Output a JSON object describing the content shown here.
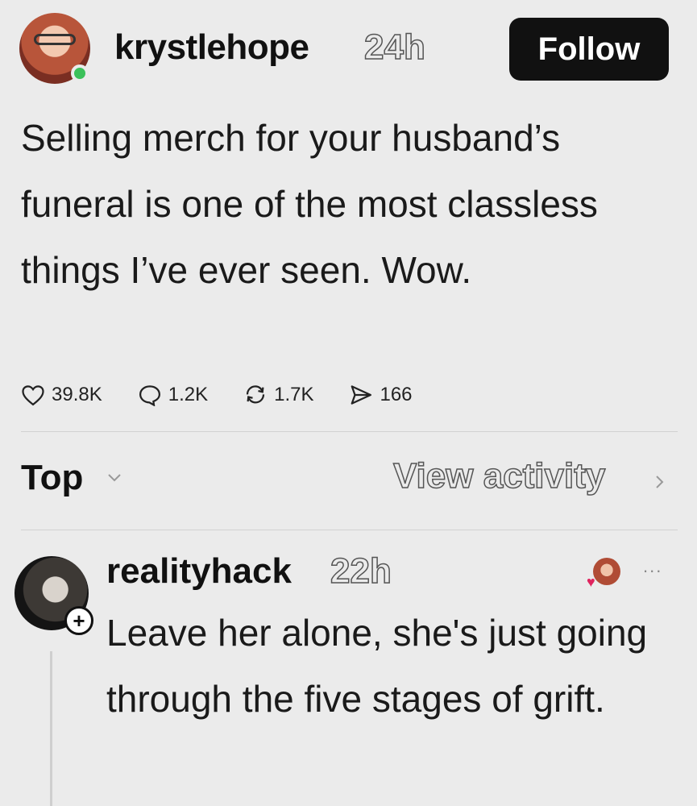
{
  "post": {
    "username": "krystlehope",
    "time": "24h",
    "follow_label": "Follow",
    "text": "Selling merch for your husband’s funeral is one of the most classless things I’ve ever seen. Wow.",
    "stats": {
      "likes": "39.8K",
      "comments": "1.2K",
      "reposts": "1.7K",
      "shares": "166"
    }
  },
  "sort": {
    "label": "Top",
    "view_activity": "View activity"
  },
  "reply": {
    "username": "realityhack",
    "time": "22h",
    "more": "...",
    "text": "Leave her alone, she's just going through the five stages of grift."
  },
  "colors": {
    "background": "#ebebeb",
    "follow_button": "#111111",
    "online_dot": "#3bc15a",
    "heart": "#e0245e"
  }
}
